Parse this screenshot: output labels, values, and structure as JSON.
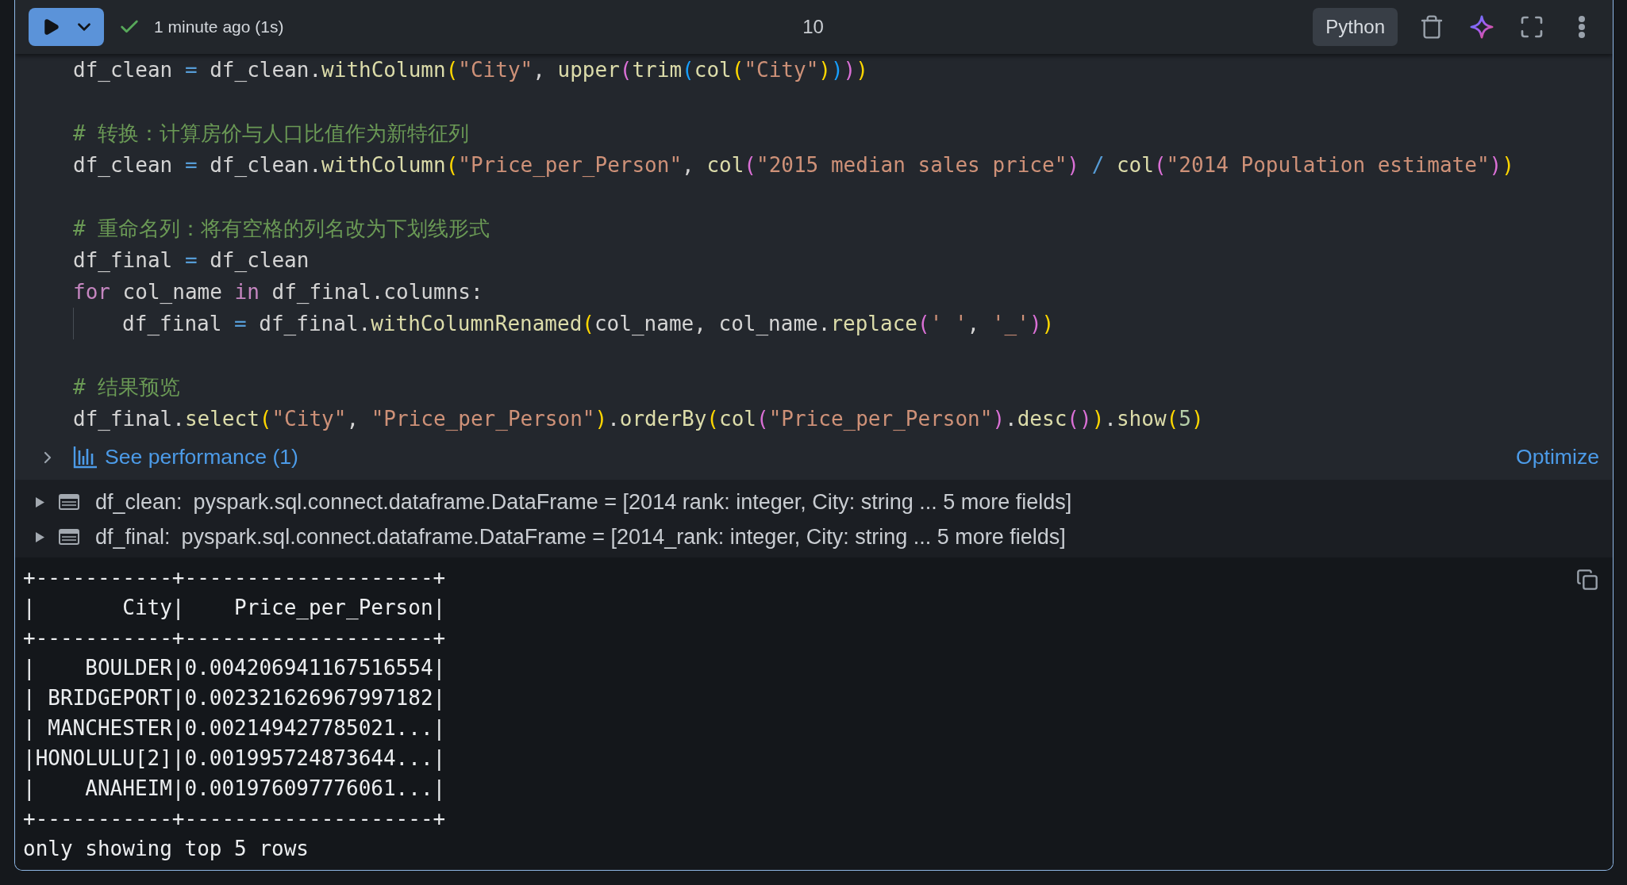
{
  "toolbar": {
    "run_succeeded": true,
    "run_time": "1 minute ago (1s)",
    "execution_count": "10",
    "language": "Python"
  },
  "code": {
    "blocks": [
      {
        "lines": [
          {
            "tokens": [
              {
                "text": "df_clean ",
                "kind": "text"
              },
              {
                "text": "=",
                "kind": "operator"
              },
              {
                "text": " df_clean.",
                "kind": "text"
              },
              {
                "text": "withColumn",
                "kind": "call"
              },
              {
                "text": "(",
                "kind": "bracket1"
              },
              {
                "text": "\"City\"",
                "kind": "string"
              },
              {
                "text": ", ",
                "kind": "text"
              },
              {
                "text": "upper",
                "kind": "call"
              },
              {
                "text": "(",
                "kind": "bracket2"
              },
              {
                "text": "trim",
                "kind": "call"
              },
              {
                "text": "(",
                "kind": "bracket3"
              },
              {
                "text": "col",
                "kind": "call"
              },
              {
                "text": "(",
                "kind": "bracket1"
              },
              {
                "text": "\"City\"",
                "kind": "string"
              },
              {
                "text": ")",
                "kind": "bracket1"
              },
              {
                "text": ")",
                "kind": "bracket3"
              },
              {
                "text": ")",
                "kind": "bracket2"
              },
              {
                "text": ")",
                "kind": "bracket1"
              }
            ]
          }
        ]
      },
      {
        "lines": [
          {
            "tokens": [
              {
                "text": "# 转换：计算房价与人口比值作为新特征列",
                "kind": "comment"
              }
            ]
          },
          {
            "tokens": [
              {
                "text": "df_clean ",
                "kind": "text"
              },
              {
                "text": "=",
                "kind": "operator"
              },
              {
                "text": " df_clean.",
                "kind": "text"
              },
              {
                "text": "withColumn",
                "kind": "call"
              },
              {
                "text": "(",
                "kind": "bracket1"
              },
              {
                "text": "\"Price_per_Person\"",
                "kind": "string"
              },
              {
                "text": ", ",
                "kind": "text"
              },
              {
                "text": "col",
                "kind": "call"
              },
              {
                "text": "(",
                "kind": "bracket2"
              },
              {
                "text": "\"2015 median sales price\"",
                "kind": "string"
              },
              {
                "text": ")",
                "kind": "bracket2"
              },
              {
                "text": " / ",
                "kind": "operator"
              },
              {
                "text": "col",
                "kind": "call"
              },
              {
                "text": "(",
                "kind": "bracket2"
              },
              {
                "text": "\"2014 Population estimate\"",
                "kind": "string"
              },
              {
                "text": ")",
                "kind": "bracket2"
              },
              {
                "text": ")",
                "kind": "bracket1"
              }
            ]
          }
        ]
      },
      {
        "lines": [
          {
            "tokens": [
              {
                "text": "# 重命名列：将有空格的列名改为下划线形式",
                "kind": "comment"
              }
            ]
          },
          {
            "tokens": [
              {
                "text": "df_final ",
                "kind": "text"
              },
              {
                "text": "=",
                "kind": "operator"
              },
              {
                "text": " df_clean",
                "kind": "text"
              }
            ]
          },
          {
            "tokens": [
              {
                "text": "for",
                "kind": "keyword"
              },
              {
                "text": " col_name ",
                "kind": "text"
              },
              {
                "text": "in",
                "kind": "keyword"
              },
              {
                "text": " df_final.columns:",
                "kind": "text"
              }
            ],
            "children": [
              {
                "tokens": [
                  {
                    "text": "df_final ",
                    "kind": "text"
                  },
                  {
                    "text": "=",
                    "kind": "operator"
                  },
                  {
                    "text": " df_final.",
                    "kind": "text"
                  },
                  {
                    "text": "withColumnRenamed",
                    "kind": "call"
                  },
                  {
                    "text": "(",
                    "kind": "bracket1"
                  },
                  {
                    "text": "col_name, col_name.",
                    "kind": "text"
                  },
                  {
                    "text": "replace",
                    "kind": "call"
                  },
                  {
                    "text": "(",
                    "kind": "bracket2"
                  },
                  {
                    "text": "' '",
                    "kind": "string"
                  },
                  {
                    "text": ", ",
                    "kind": "text"
                  },
                  {
                    "text": "'_'",
                    "kind": "string"
                  },
                  {
                    "text": ")",
                    "kind": "bracket2"
                  },
                  {
                    "text": ")",
                    "kind": "bracket1"
                  }
                ]
              }
            ]
          }
        ]
      },
      {
        "lines": [
          {
            "tokens": [
              {
                "text": "# 结果预览",
                "kind": "comment"
              }
            ]
          },
          {
            "tokens": [
              {
                "text": "df_final.",
                "kind": "text"
              },
              {
                "text": "select",
                "kind": "call"
              },
              {
                "text": "(",
                "kind": "bracket1"
              },
              {
                "text": "\"City\"",
                "kind": "string"
              },
              {
                "text": ", ",
                "kind": "text"
              },
              {
                "text": "\"Price_per_Person\"",
                "kind": "string"
              },
              {
                "text": ")",
                "kind": "bracket1"
              },
              {
                "text": ".",
                "kind": "text"
              },
              {
                "text": "orderBy",
                "kind": "call"
              },
              {
                "text": "(",
                "kind": "bracket1"
              },
              {
                "text": "col",
                "kind": "call"
              },
              {
                "text": "(",
                "kind": "bracket2"
              },
              {
                "text": "\"Price_per_Person\"",
                "kind": "string"
              },
              {
                "text": ")",
                "kind": "bracket2"
              },
              {
                "text": ".",
                "kind": "text"
              },
              {
                "text": "desc",
                "kind": "call"
              },
              {
                "text": "(",
                "kind": "bracket2"
              },
              {
                "text": ")",
                "kind": "bracket2"
              },
              {
                "text": ")",
                "kind": "bracket1"
              },
              {
                "text": ".",
                "kind": "text"
              },
              {
                "text": "show",
                "kind": "call"
              },
              {
                "text": "(",
                "kind": "bracket1"
              },
              {
                "text": "5",
                "kind": "number"
              },
              {
                "text": ")",
                "kind": "bracket1"
              }
            ]
          }
        ]
      }
    ]
  },
  "performance": {
    "label": "See performance (1)",
    "expanded": false,
    "action": "Optimize"
  },
  "variables": [
    {
      "name": "df_clean:",
      "type": "pyspark.sql.connect.dataframe.DataFrame = [2014 rank: integer, City: string ... 5 more fields]",
      "expanded": false
    },
    {
      "name": "df_final:",
      "type": "pyspark.sql.connect.dataframe.DataFrame = [2014_rank: integer, City: string ... 5 more fields]",
      "expanded": false
    }
  ],
  "output": {
    "lines": [
      "+-----------+--------------------+",
      "|       City|    Price_per_Person|",
      "+-----------+--------------------+",
      "|    BOULDER|0.004206941167516554|",
      "| BRIDGEPORT|0.002321626967997182|",
      "| MANCHESTER|0.002149427785021...|",
      "|HONOLULU[2]|0.001995724873644...|",
      "|    ANAHEIM|0.001976097776061...|",
      "+-----------+--------------------+",
      "only showing top 5 rows"
    ]
  }
}
